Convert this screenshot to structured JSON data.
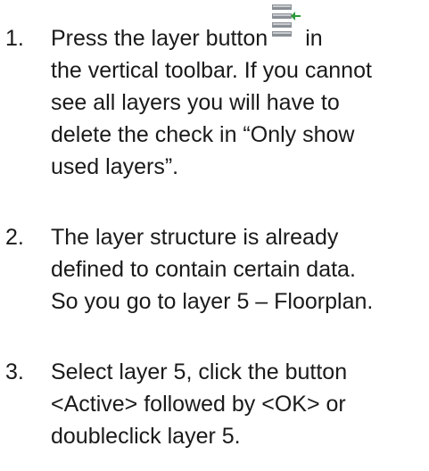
{
  "steps": [
    {
      "number": "1.",
      "lines": [
        "Press the layer button",
        "the vertical toolbar. If you cannot",
        "see all layers you will have to",
        "delete the check in “Only show",
        "used layers”."
      ],
      "after_icon": "in",
      "icon": "layer-button-icon"
    },
    {
      "number": "2.",
      "lines": [
        "The layer structure is already",
        "defined to contain certain data.",
        "So you go to layer 5 – Floorplan."
      ]
    },
    {
      "number": "3.",
      "lines": [
        "Select layer 5, click the button",
        "<Active> followed by <OK> or",
        "doubleclick layer 5."
      ]
    }
  ],
  "colors": {
    "text": "#1a1a1a",
    "icon_bar": "#8a8f95",
    "icon_bar_light": "#c8ccd0",
    "icon_arrow": "#2e9a3a"
  }
}
